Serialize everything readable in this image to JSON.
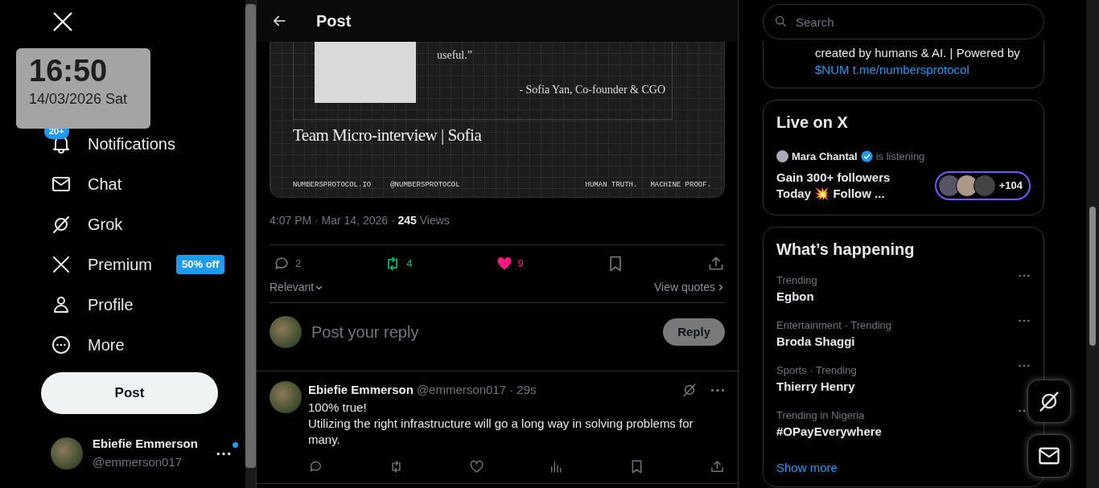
{
  "clock_overlay": {
    "time": "16:50",
    "date": "14/03/2026 Sat"
  },
  "sidebar": {
    "items": [
      {
        "label": "Notifications",
        "kind": "bell",
        "selected": false,
        "badge": "20+"
      },
      {
        "label": "Chat",
        "kind": "mail",
        "selected": false
      },
      {
        "label": "Grok",
        "kind": "grok",
        "selected": false
      },
      {
        "label": "Premium",
        "kind": "x",
        "selected": false,
        "tag": "50% off"
      },
      {
        "label": "Profile",
        "kind": "person",
        "selected": false
      },
      {
        "label": "More",
        "kind": "more",
        "selected": false
      }
    ],
    "post_button": "Post",
    "account": {
      "name": "Ebiefie Emmerson",
      "handle": "@emmerson017",
      "unread": true
    }
  },
  "main": {
    "header": {
      "title": "Post"
    },
    "media": {
      "quote_tail": "useful.”",
      "attribution": "- Sofia Yan, Co-founder & CGO",
      "title": "Team Micro-interview | Sofia",
      "footer_left": [
        "NUMBERSPROTOCOL.IO",
        "@NUMBERSPROTOCOL"
      ],
      "footer_right": [
        "HUMAN TRUTH.",
        "MACHINE PROOF."
      ]
    },
    "meta": "4:07 PM · Mar 14, 2026 · **245** Views",
    "actions": [
      {
        "kind": "reply",
        "count": "2",
        "active": false
      },
      {
        "kind": "repost",
        "count": "4",
        "active": true
      },
      {
        "kind": "like",
        "count": "9",
        "active": true
      },
      {
        "kind": "bookmark",
        "active": false
      },
      {
        "kind": "share",
        "active": false
      }
    ],
    "sort": "Relevant",
    "view_quotes": "View quotes",
    "composer": {
      "placeholder": "Post your reply",
      "button": "Reply",
      "disabled": true
    },
    "reply": {
      "name": "Ebiefie Emmerson",
      "handle": "@emmerson017 · 29s",
      "lines": [
        "100% true!",
        "Utilizing the right infrastructure will go a long way in solving problems for many."
      ],
      "actions": [
        {
          "kind": "reply",
          "active": false
        },
        {
          "kind": "repost",
          "active": false
        },
        {
          "kind": "like",
          "active": false
        },
        {
          "kind": "views",
          "active": false
        },
        {
          "kind": "bookmark",
          "active": false
        },
        {
          "kind": "share",
          "active": false
        }
      ]
    }
  },
  "right": {
    "search": {
      "placeholder": "Search"
    },
    "bio": {
      "text": "created by humans & AI. | Powered by",
      "link": "$NUM t.me/numbersprotocol"
    },
    "live": {
      "title": "Live on X",
      "host": "Mara Chantal",
      "verified": true,
      "status": "is listening",
      "space_title": "Gain 300+ followers Today 💥 Follow ...",
      "listeners": "+104"
    },
    "trends": {
      "title": "What’s happening",
      "items": [
        {
          "context": "Trending",
          "name": "Egbon"
        },
        {
          "context": "Entertainment · Trending",
          "name": "Broda Shaggi"
        },
        {
          "context": "Sports · Trending",
          "name": "Thierry Henry"
        },
        {
          "context": "Trending in Nigeria",
          "name": "#OPayEverywhere"
        }
      ],
      "show_more": "Show more"
    }
  },
  "floating": [
    {
      "kind": "grok"
    },
    {
      "kind": "mail"
    }
  ]
}
